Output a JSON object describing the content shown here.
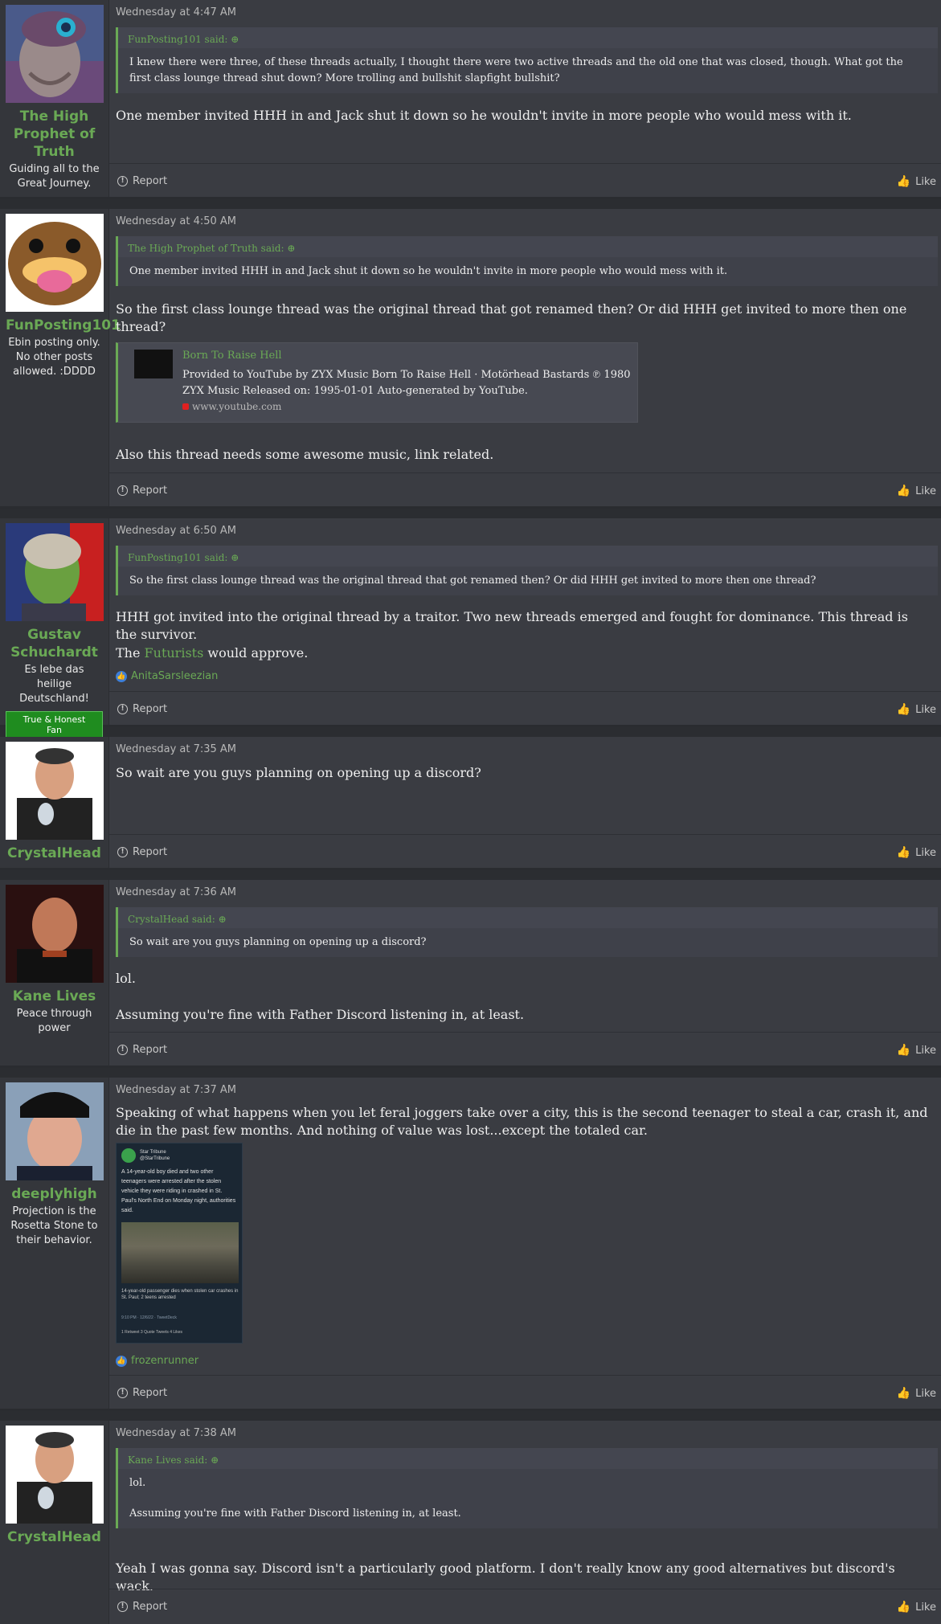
{
  "labels": {
    "report": "Report",
    "like": "Like"
  },
  "posts": [
    {
      "user": {
        "name": "The High Prophet of Truth",
        "title": "Guiding all to the Great Journey."
      },
      "date": "Wednesday at 4:47 AM",
      "quote": {
        "author": "FunPosting101 said:",
        "text": "I knew there were three, of these threads actually, I thought there were two active threads and the old one that was closed, though. What got the first class lounge thread shut down? More trolling and bullshit slapfight bullshit?"
      },
      "body": [
        "One member invited HHH in and Jack shut it down so he wouldn't invite in more people who would mess with it."
      ]
    },
    {
      "user": {
        "name": "FunPosting101",
        "title": "Ebin posting only. No other posts allowed. :DDDD"
      },
      "date": "Wednesday at 4:50 AM",
      "quote": {
        "author": "The High Prophet of Truth said:",
        "text": "One member invited HHH in and Jack shut it down so he wouldn't invite in more people who would mess with it."
      },
      "body": [
        "So the first class lounge thread was the original thread that got renamed then? Or did HHH get invited to more then one thread?",
        "Also this thread needs some awesome music, link related."
      ],
      "embed": {
        "title": "Born To Raise Hell",
        "description": "Provided to YouTube by ZYX Music Born To Raise Hell · Motörhead Bastards ℗ 1980 ZYX Music Released on: 1995-01-01 Auto-generated by YouTube.",
        "site": "www.youtube.com"
      }
    },
    {
      "user": {
        "name": "Gustav Schuchardt",
        "title": "Es lebe das heilige Deutschland!",
        "badge": "True & Honest Fan"
      },
      "date": "Wednesday at 6:50 AM",
      "quote": {
        "author": "FunPosting101 said:",
        "text": "So the first class lounge thread was the original thread that got renamed then? Or did HHH get invited to more then one thread?"
      },
      "body": [
        "HHH got invited into the original thread by a traitor. Two new threads emerged and fought for dominance. This thread is the survivor."
      ],
      "body2": {
        "before": "The ",
        "link": "Futurists",
        "after": " would approve."
      },
      "reaction": "AnitaSarsleezian"
    },
    {
      "user": {
        "name": "CrystalHead",
        "title": ""
      },
      "date": "Wednesday at 7:35 AM",
      "body": [
        "So wait are you guys planning on opening up a discord?"
      ]
    },
    {
      "user": {
        "name": "Kane Lives",
        "title": "Peace through power"
      },
      "date": "Wednesday at 7:36 AM",
      "quote": {
        "author": "CrystalHead said:",
        "text": "So wait are you guys planning on opening up a discord?"
      },
      "body": [
        "lol.",
        "Assuming you're fine with Father Discord listening in, at least."
      ]
    },
    {
      "user": {
        "name": "deeplyhigh",
        "title": "Projection is the Rosetta Stone to their behavior."
      },
      "date": "Wednesday at 7:37 AM",
      "body": [
        "Speaking of what happens when you let feral joggers take over a city, this is the second teenager to steal a car, crash it, and die in the past few months. And nothing of value was lost...except the totaled car."
      ],
      "tweet": {
        "account": "Star Tribune",
        "handle": "@StarTribune",
        "text": "A 14-year-old boy died and two other teenagers were arrested after the stolen vehicle they were riding in crashed in St. Paul's North End on Monday night, authorities said.",
        "caption": "14-year-old passenger dies when stolen car crashes in St. Paul; 2 teens arrested",
        "meta": "9:10 PM · 12/6/22 · TweetDeck",
        "stats": "1 Retweet   3 Quote Tweets   4 Likes"
      },
      "reaction": "frozenrunner"
    },
    {
      "user": {
        "name": "CrystalHead",
        "title": ""
      },
      "date": "Wednesday at 7:38 AM",
      "quote": {
        "author": "Kane Lives said:",
        "text1": "lol.",
        "text2": "Assuming you're fine with Father Discord listening in, at least."
      },
      "body": [
        "Yeah I was gonna say. Discord isn't a particularly good platform. I don't really know any good alternatives but discord's wack."
      ]
    }
  ]
}
